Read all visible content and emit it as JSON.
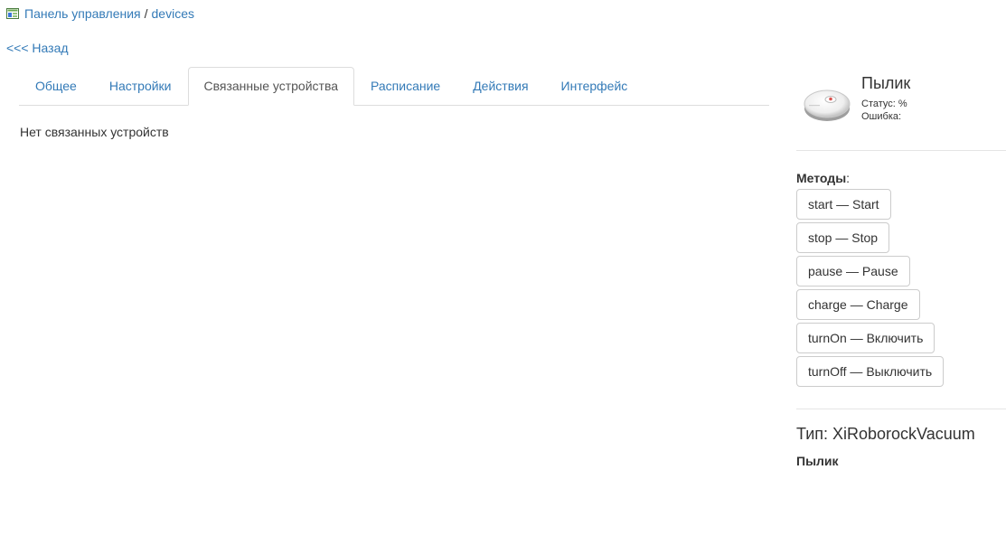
{
  "breadcrumb": {
    "icon": "control-panel-icon",
    "root_label": "Панель управления",
    "separator": "/",
    "current_label": "devices"
  },
  "back": {
    "label": "<<< Назад"
  },
  "tabs": [
    {
      "label": "Общее",
      "active": false
    },
    {
      "label": "Настройки",
      "active": false
    },
    {
      "label": "Связанные устройства",
      "active": true
    },
    {
      "label": "Расписание",
      "active": false
    },
    {
      "label": "Действия",
      "active": false
    },
    {
      "label": "Интерфейс",
      "active": false
    }
  ],
  "content": {
    "empty_message": "Нет связанных устройств"
  },
  "device": {
    "image": "robot-vacuum-icon",
    "name": "Пылик",
    "status_label": "Статус: %",
    "error_label": "Ошибка:"
  },
  "methods": {
    "label": "Методы",
    "suffix": ":",
    "items": [
      {
        "label": "start — Start"
      },
      {
        "label": "stop — Stop"
      },
      {
        "label": "pause — Pause"
      },
      {
        "label": "charge — Charge"
      },
      {
        "label": "turnOn — Включить"
      },
      {
        "label": "turnOff — Выключить"
      }
    ]
  },
  "type": {
    "label": "Тип: XiRoborockVacuum",
    "name": "Пылик"
  },
  "colors": {
    "link": "#337ab7",
    "text": "#333333",
    "border": "#dddddd"
  }
}
